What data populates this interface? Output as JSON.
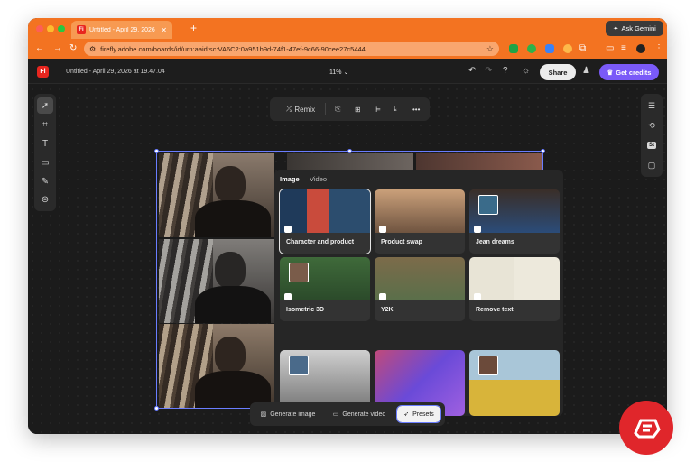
{
  "browser": {
    "tab_title": "Untitled - April 29, 2026 at 1",
    "tab_favicon": "Fi",
    "new_tab": "+",
    "ask_gemini": "Ask Gemini",
    "url": "firefly.adobe.com/boards/id/urn:aaid:sc:VA6C2:0a951b9d-74f1-47ef-9c66-90cee27c5444",
    "accent_color": "#f37321"
  },
  "app": {
    "logo": "Fi",
    "doc_title": "Untitled - April 29, 2026 at 19.47.04",
    "zoom": "11%",
    "share_label": "Share",
    "credits_label": "Get credits",
    "credits_color": "#7a5af8"
  },
  "top_toolbar": {
    "remix_label": "Remix",
    "more": "•••"
  },
  "presets_panel": {
    "tabs": [
      {
        "label": "Image"
      },
      {
        "label": "Video"
      }
    ],
    "cards": [
      {
        "label": "Character and product"
      },
      {
        "label": "Product swap"
      },
      {
        "label": "Jean dreams"
      },
      {
        "label": "Isometric 3D"
      },
      {
        "label": "Y2K"
      },
      {
        "label": "Remove text"
      }
    ]
  },
  "bottom_bar": {
    "generate_image": "Generate image",
    "generate_video": "Generate video",
    "presets": "Presets"
  }
}
